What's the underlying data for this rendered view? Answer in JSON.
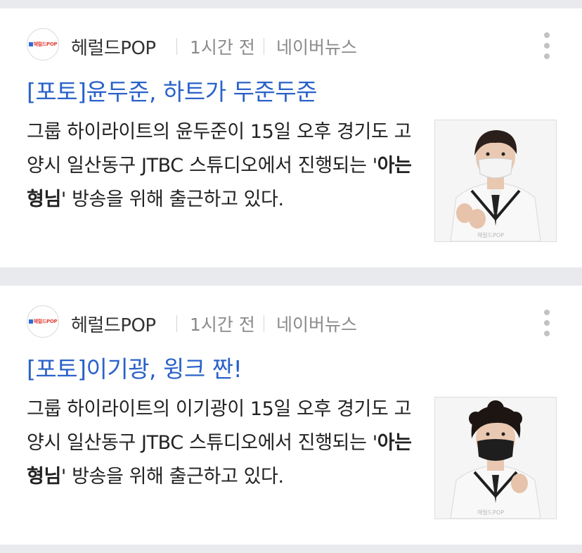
{
  "articles": [
    {
      "source": "헤럴드POP",
      "logo_text": "헤럴드POP",
      "time": "1시간 전",
      "portal": "네이버뉴스",
      "headline": "[포토]윤두준, 하트가 두준두준",
      "summary_before": "그룹 하이라이트의 윤두준이 15일 오후 경기도 고양시 일산동구 JTBC 스튜디오에서 진행되는 '",
      "summary_bold": "아는형님",
      "summary_after": "' 방송을 위해 출근하고 있다.",
      "photo_watermark": "헤럴드POP",
      "mask_color": "#f4f4f4"
    },
    {
      "source": "헤럴드POP",
      "logo_text": "헤럴드POP",
      "time": "1시간 전",
      "portal": "네이버뉴스",
      "headline": "[포토]이기광, 윙크 짠!",
      "summary_before": "그룹 하이라이트의 이기광이 15일 오후 경기도 고양시 일산동구 JTBC 스튜디오에서 진행되는 '",
      "summary_bold": "아는형님",
      "summary_after": "' 방송을 위해 출근하고 있다.",
      "photo_watermark": "헤럴드POP",
      "mask_color": "#1e1e1e"
    }
  ],
  "colors": {
    "headline": "#2a62c9",
    "background": "#e9eaee"
  }
}
